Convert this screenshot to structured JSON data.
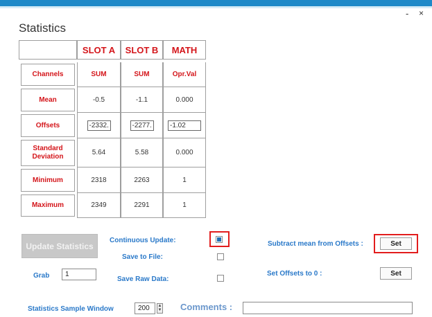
{
  "window": {
    "title": "Statistics",
    "minimize_glyph": "-",
    "close_glyph": "×"
  },
  "table": {
    "columns": [
      "SLOT A",
      "SLOT B",
      "MATH"
    ],
    "rows": [
      {
        "label": "Channels",
        "values": [
          "SUM",
          "SUM",
          "Opr.Val"
        ]
      },
      {
        "label": "Mean",
        "values": [
          "-0.5",
          "-1.1",
          "0.000"
        ]
      },
      {
        "label": "Offsets",
        "values": [
          "-2332.",
          "-2277.",
          "-1.02"
        ]
      },
      {
        "label": "Standard Deviation",
        "values": [
          "5.64",
          "5.58",
          "0.000"
        ]
      },
      {
        "label": "Minimum",
        "values": [
          "2318",
          "2263",
          "1"
        ]
      },
      {
        "label": "Maximum",
        "values": [
          "2349",
          "2291",
          "1"
        ]
      }
    ]
  },
  "controls": {
    "update_statistics": "Update Statistics",
    "continuous_update": {
      "label": "Continuous Update:",
      "checked": true
    },
    "save_to_file": {
      "label": "Save to File:",
      "checked": false
    },
    "save_raw_data": {
      "label": "Save Raw Data:",
      "checked": false
    },
    "grab": {
      "label": "Grab",
      "value": "1"
    },
    "subtract_mean": {
      "label": "Subtract mean from Offsets :",
      "button": "Set"
    },
    "set_offsets_zero": {
      "label": "Set Offsets to 0 :",
      "button": "Set"
    },
    "sample_window": {
      "label": "Statistics Sample Window",
      "value": "200"
    },
    "comments": {
      "label": "Comments :",
      "value": ""
    }
  },
  "colors": {
    "accent": "#1e89c8",
    "header_red": "#d4151a",
    "label_blue": "#2a79c9",
    "highlight": "#e21c1c"
  }
}
